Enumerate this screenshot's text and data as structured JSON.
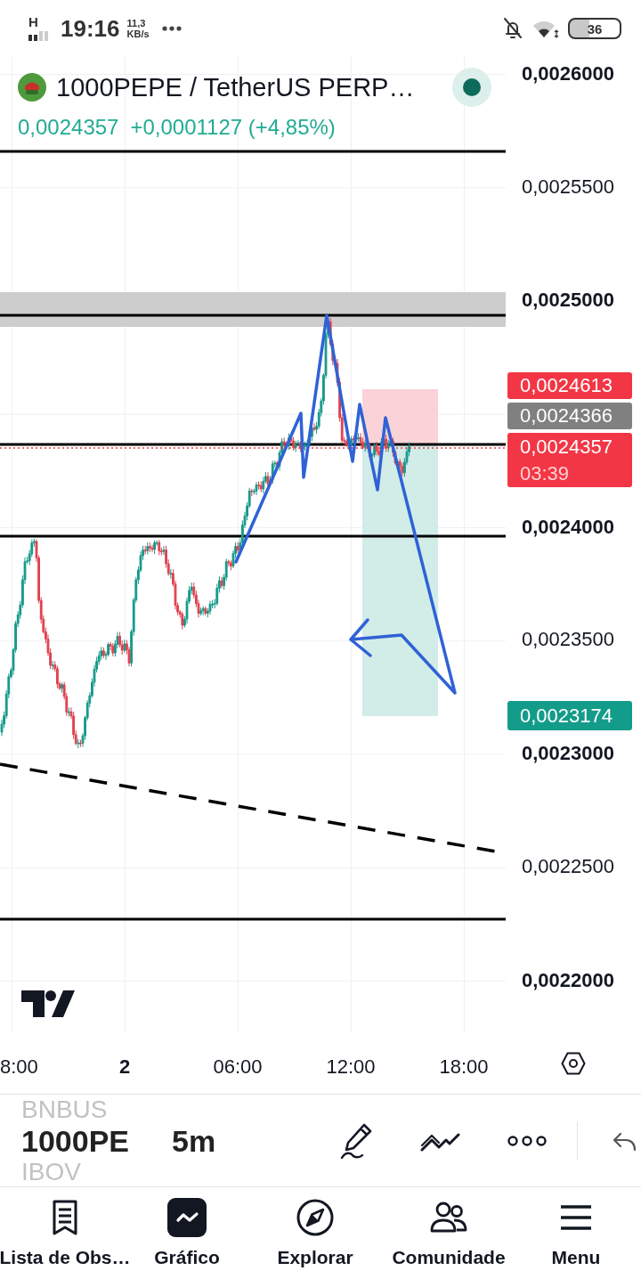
{
  "status_bar": {
    "network": "H",
    "time": "19:16",
    "speed_value": "11,3",
    "speed_unit": "KB/s",
    "battery": "36"
  },
  "symbol_header": {
    "title": "1000PEPE / TetherUS PERP…",
    "price": "0,0024357",
    "change": "+0,0001127 (+4,85%)",
    "market_open": true
  },
  "chart": {
    "price_axis": [
      {
        "label": "0,0026000",
        "major": true
      },
      {
        "label": "0,0025500",
        "major": false
      },
      {
        "label": "0,0025000",
        "major": true
      },
      {
        "label": "0,0024000",
        "major": true
      },
      {
        "label": "0,0023500",
        "major": false
      },
      {
        "label": "0,0023000",
        "major": true
      },
      {
        "label": "0,0022500",
        "major": false
      },
      {
        "label": "0,0022000",
        "major": true
      }
    ],
    "price_tags": [
      {
        "price": "0,0024613",
        "color": "#f23645"
      },
      {
        "price": "0,0024366",
        "color": "#808080"
      },
      {
        "price": "0,0024357",
        "countdown": "03:39",
        "color": "#f23645"
      },
      {
        "price": "0,0023174",
        "color": "#149c8a"
      }
    ],
    "time_axis": [
      {
        "label": "8:00",
        "major": false
      },
      {
        "label": "2",
        "major": true
      },
      {
        "label": "06:00",
        "major": false
      },
      {
        "label": "12:00",
        "major": false
      },
      {
        "label": "18:00",
        "major": false
      }
    ]
  },
  "toolbar": {
    "symbols": [
      {
        "label": "BNBUS",
        "selected": false
      },
      {
        "label": "1000PE",
        "selected": true
      },
      {
        "label": "IBOV",
        "selected": false
      }
    ],
    "interval": "5m"
  },
  "nav": [
    {
      "label": "Lista de Obs…",
      "selected": false
    },
    {
      "label": "Gráfico",
      "selected": true
    },
    {
      "label": "Explorar",
      "selected": false
    },
    {
      "label": "Comunidade",
      "selected": false
    },
    {
      "label": "Menu",
      "selected": false
    }
  ]
}
